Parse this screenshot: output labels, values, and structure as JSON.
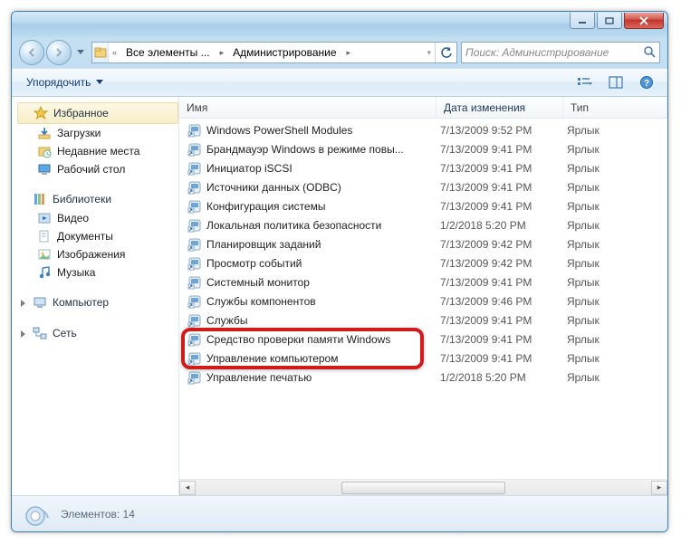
{
  "breadcrumb": {
    "root_label": "Все элементы ...",
    "current_label": "Администрирование"
  },
  "search": {
    "placeholder": "Поиск: Администрирование"
  },
  "toolbar": {
    "organize_label": "Упорядочить"
  },
  "sidebar": {
    "favorites_label": "Избранное",
    "favorites": [
      {
        "label": "Загрузки",
        "icon": "downloads-icon"
      },
      {
        "label": "Недавние места",
        "icon": "recent-icon"
      },
      {
        "label": "Рабочий стол",
        "icon": "desktop-icon"
      }
    ],
    "libraries_label": "Библиотеки",
    "libraries": [
      {
        "label": "Видео",
        "icon": "video-icon"
      },
      {
        "label": "Документы",
        "icon": "documents-icon"
      },
      {
        "label": "Изображения",
        "icon": "pictures-icon"
      },
      {
        "label": "Музыка",
        "icon": "music-icon"
      }
    ],
    "computer_label": "Компьютер",
    "network_label": "Сеть"
  },
  "columns": {
    "name": "Имя",
    "date": "Дата изменения",
    "type": "Тип"
  },
  "type_label": "Ярлык",
  "files": [
    {
      "name": "Windows PowerShell Modules",
      "date": "7/13/2009 9:52 PM"
    },
    {
      "name": "Брандмауэр Windows в режиме повы...",
      "date": "7/13/2009 9:41 PM"
    },
    {
      "name": "Инициатор iSCSI",
      "date": "7/13/2009 9:41 PM"
    },
    {
      "name": "Источники данных (ODBC)",
      "date": "7/13/2009 9:41 PM"
    },
    {
      "name": "Конфигурация системы",
      "date": "7/13/2009 9:41 PM"
    },
    {
      "name": "Локальная политика безопасности",
      "date": "1/2/2018 5:20 PM"
    },
    {
      "name": "Планировщик заданий",
      "date": "7/13/2009 9:42 PM"
    },
    {
      "name": "Просмотр событий",
      "date": "7/13/2009 9:42 PM"
    },
    {
      "name": "Системный монитор",
      "date": "7/13/2009 9:41 PM"
    },
    {
      "name": "Службы компонентов",
      "date": "7/13/2009 9:46 PM"
    },
    {
      "name": "Службы",
      "date": "7/13/2009 9:41 PM"
    },
    {
      "name": "Средство проверки памяти Windows",
      "date": "7/13/2009 9:41 PM"
    },
    {
      "name": "Управление компьютером",
      "date": "7/13/2009 9:41 PM"
    },
    {
      "name": "Управление печатью",
      "date": "1/2/2018 5:20 PM"
    }
  ],
  "status": {
    "text": "Элементов: 14"
  },
  "highlight_index": 12
}
